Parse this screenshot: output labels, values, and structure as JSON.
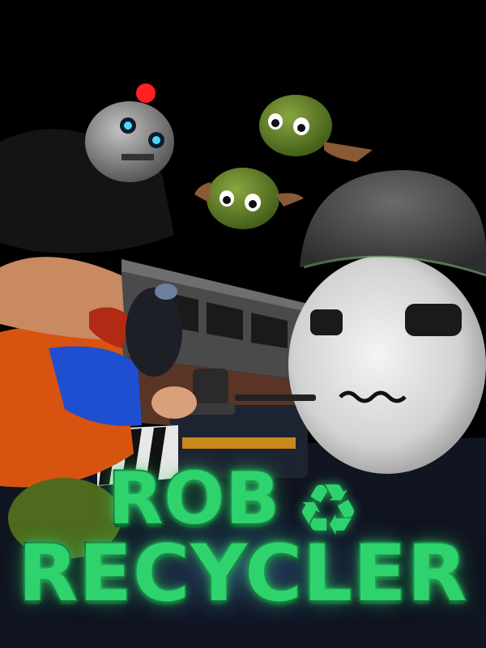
{
  "game": {
    "title_line_1": "ROB",
    "title_line_2": "RECYCLER",
    "logo_icon": "recycle-icon",
    "logo_icon_glyph": "♻"
  },
  "colors": {
    "background": "#000000",
    "logo_green": "#2fd36d",
    "logo_outline": "#0c4a2a",
    "slime_green": "#5f7a24",
    "blob_white": "#d9d9d9",
    "robot_grey": "#8a8a8a",
    "beacon_red": "#ff2020",
    "shirt_orange": "#d8530f",
    "sleeve_blue": "#1e4fd0"
  }
}
